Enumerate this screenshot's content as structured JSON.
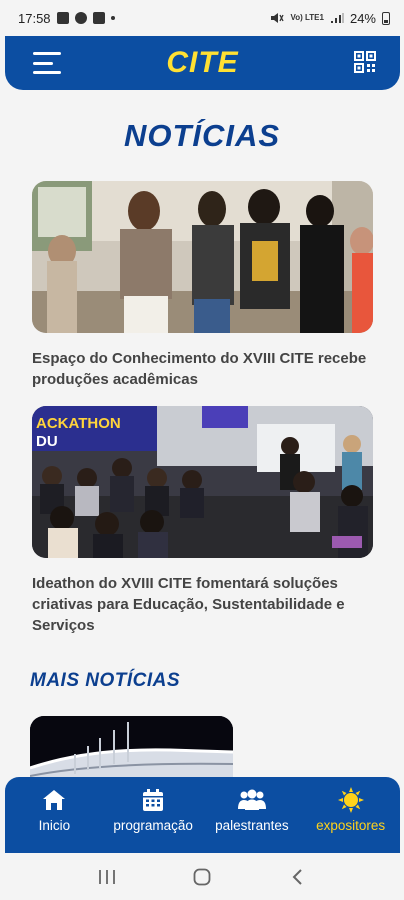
{
  "status_bar": {
    "time": "17:58",
    "battery": "24%",
    "network": "Vo) LTE1"
  },
  "header": {
    "title": "CITE",
    "menu_icon": "hamburger-menu-icon",
    "qr_icon": "qr-code-icon"
  },
  "page": {
    "title": "NOTÍCIAS"
  },
  "news": [
    {
      "title": "Espaço do Conhecimento do XVIII CITE recebe produções acadêmicas"
    },
    {
      "title": "Ideathon do XVIII CITE fomentará soluções criativas para Educação, Sustentabilidade e Serviços",
      "banner_text": "ACKATHON",
      "banner_text_2": "DU"
    }
  ],
  "more_news": {
    "title": "MAIS NOTÍCIAS"
  },
  "bottom_nav": [
    {
      "label": "Inicio",
      "icon": "home-icon",
      "active": false
    },
    {
      "label": "programação",
      "icon": "calendar-icon",
      "active": false
    },
    {
      "label": "palestrantes",
      "icon": "people-icon",
      "active": false
    },
    {
      "label": "expositores",
      "icon": "sun-icon",
      "active": true
    }
  ],
  "colors": {
    "primary": "#0c4ea2",
    "title_blue": "#0c3f8f",
    "accent_yellow": "#ffe033",
    "active_yellow": "#ffd21a"
  }
}
